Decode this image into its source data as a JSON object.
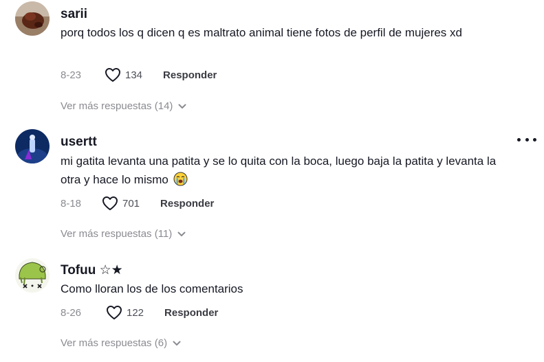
{
  "comments": [
    {
      "username": "sarii",
      "text": "porq todos los q dicen q es maltrato animal tiene fotos de perfil de mujeres xd",
      "date": "8-23",
      "likes": "134",
      "reply_label": "Responder",
      "view_replies": "Ver más respuestas (14)",
      "avatar_icon": "avatar-photo-dark-red"
    },
    {
      "username": "usertt",
      "text": "mi gatita levanta una patita y se lo quita con la boca, luego baja la patita y levanta la otra y hace lo mismo",
      "emoji": "crying-face-emoji",
      "date": "8-18",
      "likes": "701",
      "reply_label": "Responder",
      "view_replies": "Ver más respuestas (11)",
      "avatar_icon": "avatar-blue-figure"
    },
    {
      "username": "Tofuu ☆★",
      "text": "Como lloran los de los comentarios",
      "date": "8-26",
      "likes": "122",
      "reply_label": "Responder",
      "view_replies": "Ver más respuestas (6)",
      "avatar_icon": "avatar-green-sketch"
    }
  ],
  "colors": {
    "text_primary": "#161823",
    "text_secondary": "#8a8b91",
    "reply": "#3a3b42"
  }
}
